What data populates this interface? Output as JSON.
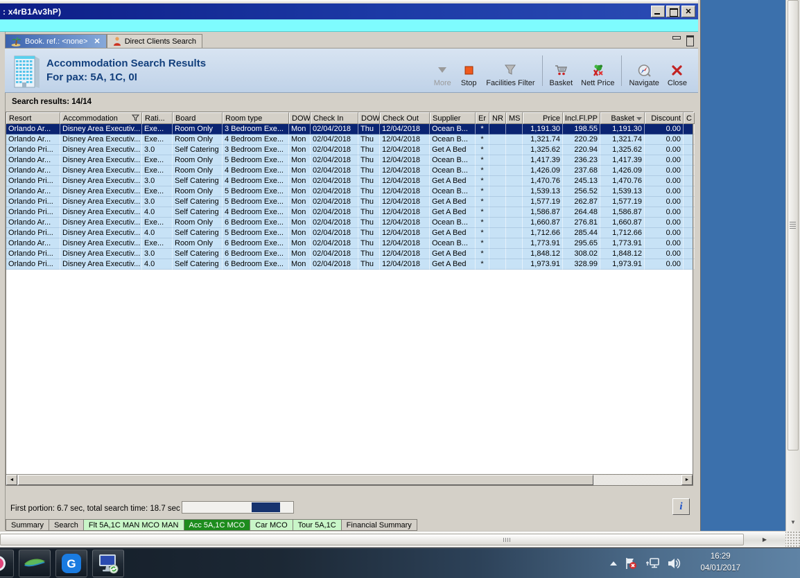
{
  "window": {
    "title": ": x4rB1Av3hP)"
  },
  "doc_tabs": {
    "active_label": "Book. ref.: <none>",
    "inactive_label": "Direct Clients Search"
  },
  "header": {
    "title": "Accommodation Search Results",
    "subtitle": "For pax: 5A, 1C, 0I"
  },
  "toolbar": {
    "more": "More",
    "stop": "Stop",
    "facilities_filter": "Facilities Filter",
    "basket": "Basket",
    "nett_price": "Nett Price",
    "navigate": "Navigate",
    "close": "Close"
  },
  "results": {
    "label": "Search results: 14/14"
  },
  "table": {
    "columns": [
      {
        "label": "Resort"
      },
      {
        "label": "Accommodation",
        "icon": "filter-funnel-icon"
      },
      {
        "label": "Rati..."
      },
      {
        "label": "Board"
      },
      {
        "label": "Room type"
      },
      {
        "label": "DOW"
      },
      {
        "label": "Check In"
      },
      {
        "label": "DOW"
      },
      {
        "label": "Check Out"
      },
      {
        "label": "Supplier"
      },
      {
        "label": "Er"
      },
      {
        "label": "NR"
      },
      {
        "label": "MS"
      },
      {
        "label": "Price",
        "align": "right"
      },
      {
        "label": "Incl.Fl.PP",
        "align": "right"
      },
      {
        "label": "Basket",
        "align": "right",
        "icon": "sort-desc-icon"
      },
      {
        "label": "Discount",
        "align": "right"
      },
      {
        "label": "C"
      }
    ],
    "selected_row_index": 0,
    "rows": [
      [
        "Orlando Ar...",
        "Disney Area Executiv...",
        "Exe...",
        "Room Only",
        "3 Bedroom Exe...",
        "Mon",
        "02/04/2018",
        "Thu",
        "12/04/2018",
        "Ocean B...",
        "*",
        "",
        "",
        "1,191.30",
        "198.55",
        "1,191.30",
        "0.00",
        ""
      ],
      [
        "Orlando Ar...",
        "Disney Area Executiv...",
        "Exe...",
        "Room Only",
        "4 Bedroom Exe...",
        "Mon",
        "02/04/2018",
        "Thu",
        "12/04/2018",
        "Ocean B...",
        "*",
        "",
        "",
        "1,321.74",
        "220.29",
        "1,321.74",
        "0.00",
        ""
      ],
      [
        "Orlando Pri...",
        "Disney Area Executiv...",
        "3.0",
        "Self Catering",
        "3 Bedroom Exe...",
        "Mon",
        "02/04/2018",
        "Thu",
        "12/04/2018",
        "Get A Bed",
        "*",
        "",
        "",
        "1,325.62",
        "220.94",
        "1,325.62",
        "0.00",
        ""
      ],
      [
        "Orlando Ar...",
        "Disney Area Executiv...",
        "Exe...",
        "Room Only",
        "5 Bedroom Exe...",
        "Mon",
        "02/04/2018",
        "Thu",
        "12/04/2018",
        "Ocean B...",
        "*",
        "",
        "",
        "1,417.39",
        "236.23",
        "1,417.39",
        "0.00",
        ""
      ],
      [
        "Orlando Ar...",
        "Disney Area Executiv...",
        "Exe...",
        "Room Only",
        "4 Bedroom Exe...",
        "Mon",
        "02/04/2018",
        "Thu",
        "12/04/2018",
        "Ocean B...",
        "*",
        "",
        "",
        "1,426.09",
        "237.68",
        "1,426.09",
        "0.00",
        ""
      ],
      [
        "Orlando Pri...",
        "Disney Area Executiv...",
        "3.0",
        "Self Catering",
        "4 Bedroom Exe...",
        "Mon",
        "02/04/2018",
        "Thu",
        "12/04/2018",
        "Get A Bed",
        "*",
        "",
        "",
        "1,470.76",
        "245.13",
        "1,470.76",
        "0.00",
        ""
      ],
      [
        "Orlando Ar...",
        "Disney Area Executiv...",
        "Exe...",
        "Room Only",
        "5 Bedroom Exe...",
        "Mon",
        "02/04/2018",
        "Thu",
        "12/04/2018",
        "Ocean B...",
        "*",
        "",
        "",
        "1,539.13",
        "256.52",
        "1,539.13",
        "0.00",
        ""
      ],
      [
        "Orlando Pri...",
        "Disney Area Executiv...",
        "3.0",
        "Self Catering",
        "5 Bedroom Exe...",
        "Mon",
        "02/04/2018",
        "Thu",
        "12/04/2018",
        "Get A Bed",
        "*",
        "",
        "",
        "1,577.19",
        "262.87",
        "1,577.19",
        "0.00",
        ""
      ],
      [
        "Orlando Pri...",
        "Disney Area Executiv...",
        "4.0",
        "Self Catering",
        "4 Bedroom Exe...",
        "Mon",
        "02/04/2018",
        "Thu",
        "12/04/2018",
        "Get A Bed",
        "*",
        "",
        "",
        "1,586.87",
        "264.48",
        "1,586.87",
        "0.00",
        ""
      ],
      [
        "Orlando Ar...",
        "Disney Area Executiv...",
        "Exe...",
        "Room Only",
        "6 Bedroom Exe...",
        "Mon",
        "02/04/2018",
        "Thu",
        "12/04/2018",
        "Ocean B...",
        "*",
        "",
        "",
        "1,660.87",
        "276.81",
        "1,660.87",
        "0.00",
        ""
      ],
      [
        "Orlando Pri...",
        "Disney Area Executiv...",
        "4.0",
        "Self Catering",
        "5 Bedroom Exe...",
        "Mon",
        "02/04/2018",
        "Thu",
        "12/04/2018",
        "Get A Bed",
        "*",
        "",
        "",
        "1,712.66",
        "285.44",
        "1,712.66",
        "0.00",
        ""
      ],
      [
        "Orlando Ar...",
        "Disney Area Executiv...",
        "Exe...",
        "Room Only",
        "6 Bedroom Exe...",
        "Mon",
        "02/04/2018",
        "Thu",
        "12/04/2018",
        "Ocean B...",
        "*",
        "",
        "",
        "1,773.91",
        "295.65",
        "1,773.91",
        "0.00",
        ""
      ],
      [
        "Orlando Pri...",
        "Disney Area Executiv...",
        "3.0",
        "Self Catering",
        "6 Bedroom Exe...",
        "Mon",
        "02/04/2018",
        "Thu",
        "12/04/2018",
        "Get A Bed",
        "*",
        "",
        "",
        "1,848.12",
        "308.02",
        "1,848.12",
        "0.00",
        ""
      ],
      [
        "Orlando Pri...",
        "Disney Area Executiv...",
        "4.0",
        "Self Catering",
        "6 Bedroom Exe...",
        "Mon",
        "02/04/2018",
        "Thu",
        "12/04/2018",
        "Get A Bed",
        "*",
        "",
        "",
        "1,973.91",
        "328.99",
        "1,973.91",
        "0.00",
        ""
      ]
    ]
  },
  "status": {
    "text": "First portion: 6.7 sec, total search time: 18.7 sec",
    "info_button": "i"
  },
  "bottom_tabs": [
    {
      "label": "Summary",
      "state": "normal"
    },
    {
      "label": "Search",
      "state": "normal"
    },
    {
      "label": "Flt 5A,1C MAN MCO MAN",
      "state": "highlight"
    },
    {
      "label": "Acc 5A,1C MCO",
      "state": "selected"
    },
    {
      "label": "Car MCO",
      "state": "highlight"
    },
    {
      "label": "Tour 5A,1C",
      "state": "highlight"
    },
    {
      "label": "Financial Summary",
      "state": "normal"
    }
  ],
  "taskbar": {
    "time": "16:29",
    "date": "04/01/2017"
  },
  "colors": {
    "selection": "#0a2472",
    "row_bg": "#c7e2f6",
    "title_navy": "#123f7c",
    "tab_selected_green": "#1d8c1d",
    "tab_highlight_green": "#c9f6c8",
    "desktop_blue": "#3b70ac",
    "progress_fill": "#17336e"
  }
}
